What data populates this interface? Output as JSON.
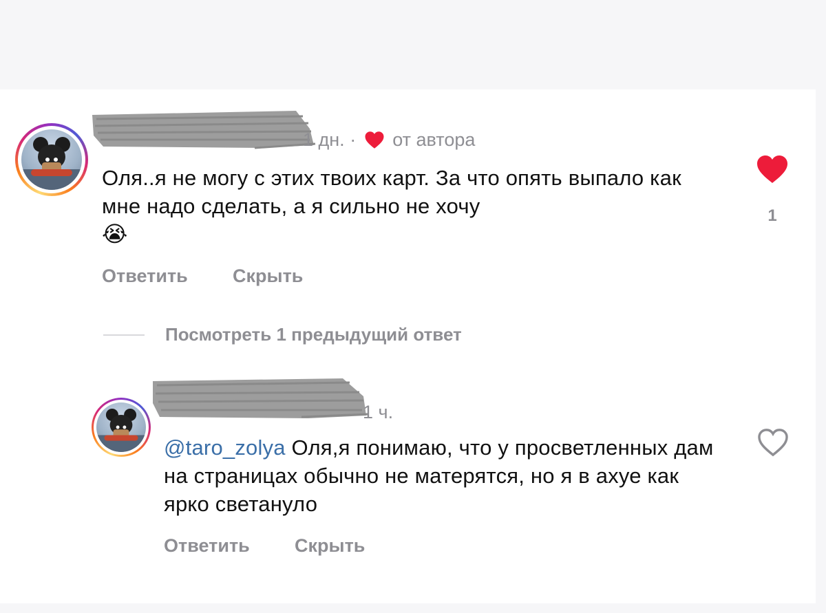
{
  "comments": [
    {
      "time": "1 дн.",
      "separator": "·",
      "liked_by_author": "от автора",
      "text": "Оля..я не могу с этих твоих карт. За что опять выпало как мне надо сделать, а я сильно не хочу",
      "emoji": "😭",
      "like_count": "1",
      "liked": true,
      "actions": {
        "reply": "Ответить",
        "hide": "Скрыть"
      }
    }
  ],
  "view_previous": "Посмотреть 1 предыдущий ответ",
  "replies": [
    {
      "time": "1 ч.",
      "mention": "@taro_zolya",
      "text": "Оля,я понимаю, что у просветленных дам на страницах обычно не матерятся, но я в ахуе как ярко светануло",
      "liked": false,
      "actions": {
        "reply": "Ответить",
        "hide": "Скрыть"
      }
    }
  ],
  "colors": {
    "heart_red": "#ed1c3a",
    "muted_text": "#8e8e93",
    "mention_blue": "#3b6fa8"
  },
  "icons": {
    "heart_filled": "heart-filled-icon",
    "heart_outline": "heart-outline-icon",
    "heart_small": "heart-small-icon"
  }
}
